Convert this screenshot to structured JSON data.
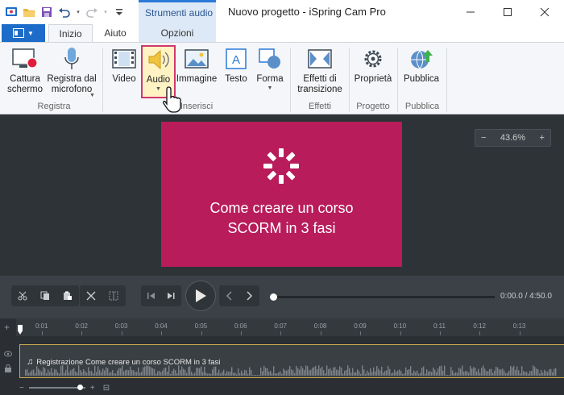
{
  "window": {
    "title": "Nuovo progetto - iSpring Cam Pro",
    "context_tab_group": "Strumenti audio",
    "controls": [
      "minimize",
      "maximize",
      "close"
    ]
  },
  "quick_access": {
    "icons": [
      "app-icon",
      "open-folder-icon",
      "save-icon",
      "undo-icon",
      "redo-icon",
      "customize-icon"
    ]
  },
  "tabs": {
    "file_icon": "file-menu-icon",
    "items": [
      {
        "label": "Inizio",
        "active": true
      },
      {
        "label": "Aiuto",
        "active": false
      },
      {
        "label": "Opzioni",
        "active": false
      }
    ]
  },
  "ribbon": {
    "buttons": {
      "cattura": "Cattura\nschermo",
      "registra": "Registra dal\nmicrofono",
      "video": "Video",
      "audio": "Audio",
      "immagine": "Immagine",
      "testo": "Testo",
      "forma": "Forma",
      "effetti": "Effetti di\ntransizione",
      "proprieta": "Proprietà",
      "pubblica": "Pubblica"
    },
    "groups": {
      "registra": "Registra",
      "inserisci": "Inserisci",
      "effetti": "Effetti",
      "progetto": "Progetto",
      "pubblica": "Pubblica"
    }
  },
  "editor": {
    "slide_title": "Come creare un corso\nSCORM in 3 fasi",
    "slide_color": "#b81c5b",
    "zoom": {
      "minus": "−",
      "value": "43.6%",
      "plus": "+"
    }
  },
  "player": {
    "time": "0:00.0 / 4:50.0",
    "position_fraction": 0.0
  },
  "timeline": {
    "ruler_ticks": [
      "0:01",
      "0:02",
      "0:03",
      "0:04",
      "0:05",
      "0:06",
      "0:07",
      "0:08",
      "0:09",
      "0:10",
      "0:11",
      "0:12",
      "0:13"
    ],
    "track_label": "Registrazione Come creare un corso  SCORM in 3 fasi",
    "track_border_color": "#c8a94a",
    "zoom_minus": "−",
    "zoom_plus": "+"
  }
}
